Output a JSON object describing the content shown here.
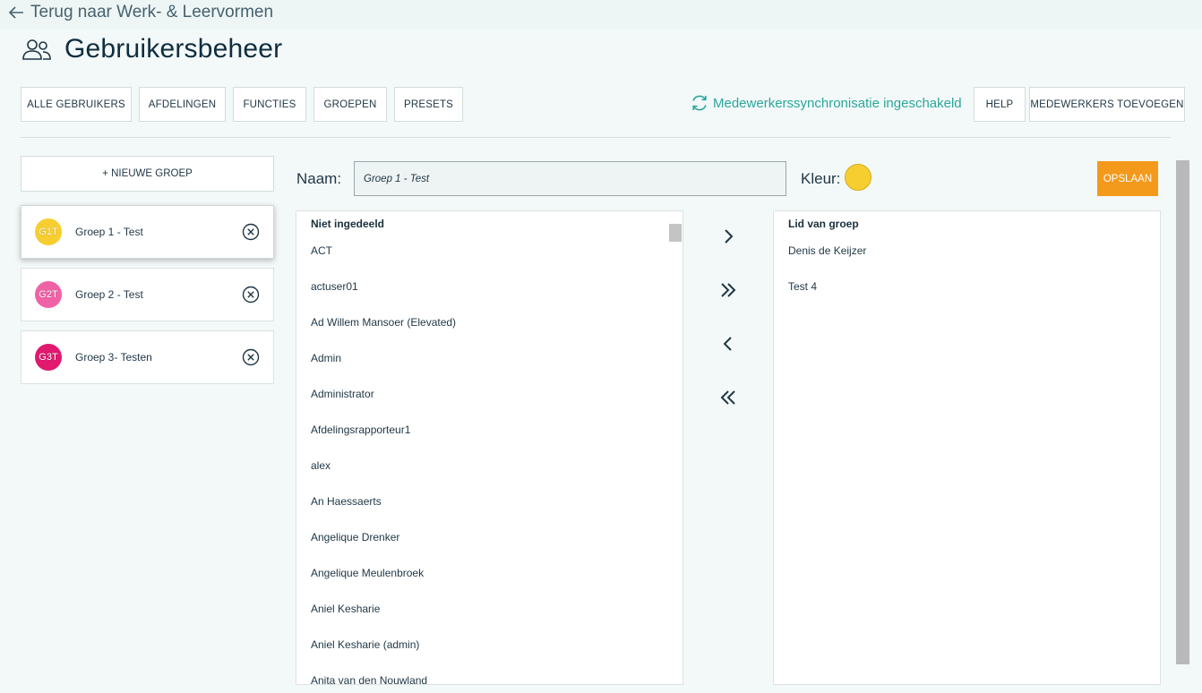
{
  "back": {
    "label": "Terug naar Werk- & Leervormen"
  },
  "page": {
    "title": "Gebruikersbeheer"
  },
  "tabs": [
    {
      "label": "ALLE GEBRUIKERS"
    },
    {
      "label": "AFDELINGEN"
    },
    {
      "label": "FUNCTIES"
    },
    {
      "label": "GROEPEN"
    },
    {
      "label": "PRESETS"
    }
  ],
  "sync": {
    "label": "Medewerkerssynchronisatie ingeschakeld"
  },
  "actions": {
    "help": "HELP",
    "add_employees": "MEDEWERKERS TOEVOEGEN"
  },
  "groups": {
    "new_label": "+ NIEUWE GROEP",
    "items": [
      {
        "badge": "G1T",
        "name": "Groep 1 - Test",
        "color": "#f7ce2f"
      },
      {
        "badge": "G2T",
        "name": "Groep 2 - Test",
        "color": "#f062a6"
      },
      {
        "badge": "G3T",
        "name": "Groep 3- Testen",
        "color": "#e0186e"
      }
    ]
  },
  "editor": {
    "name_label": "Naam:",
    "name_value": "Groep 1 - Test",
    "color_label": "Kleur:",
    "color": "#f7ce2f",
    "save_label": "OPSLAAN"
  },
  "unassigned": {
    "header": "Niet ingedeeld",
    "items": [
      "ACT",
      "actuser01",
      "Ad Willem Mansoer (Elevated)",
      "Admin",
      "Administrator",
      "Afdelingsrapporteur1",
      "alex",
      "An Haessaerts",
      "Angelique Drenker",
      "Angelique Meulenbroek",
      "Aniel Kesharie",
      "Aniel Kesharie (admin)",
      "Anita van den Nouwland"
    ]
  },
  "members": {
    "header": "Lid van groep",
    "items": [
      "Denis de Keijzer",
      "Test 4"
    ]
  },
  "colors": {
    "accent": "#2aa79b",
    "save": "#f3991c"
  }
}
